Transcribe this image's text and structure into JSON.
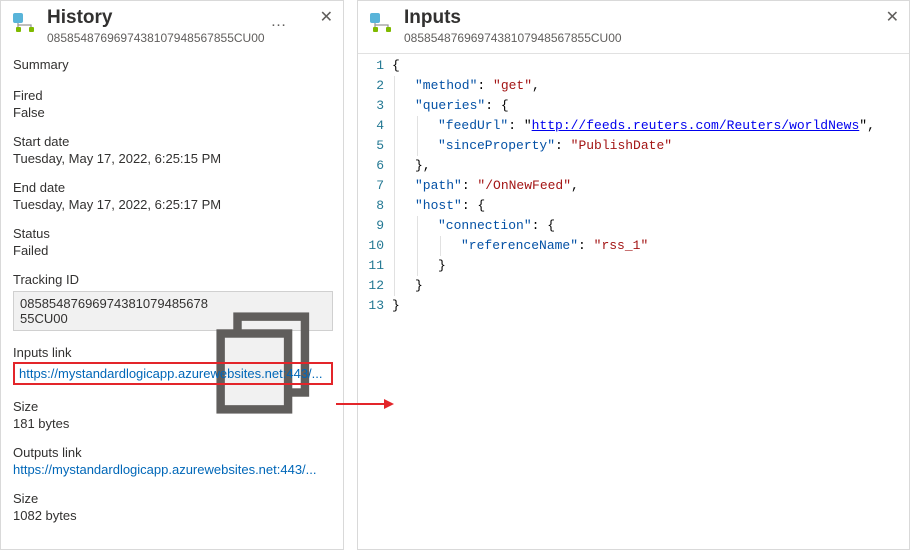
{
  "history": {
    "title": "History",
    "more": "…",
    "id": "08585487696974381079485678​55CU00",
    "summary_label": "Summary",
    "fired_label": "Fired",
    "fired_value": "False",
    "start_label": "Start date",
    "start_value": "Tuesday, May 17, 2022, 6:25:15 PM",
    "end_label": "End date",
    "end_value": "Tuesday, May 17, 2022, 6:25:17 PM",
    "status_label": "Status",
    "status_value": "Failed",
    "tracking_label": "Tracking ID",
    "tracking_value": "08585487696974381079485678​55CU00",
    "inputs_link_label": "Inputs link",
    "inputs_link_value": "https://mystandardlogicapp.azurewebsites.net:443/...",
    "inputs_size_label": "Size",
    "inputs_size_value": "181 bytes",
    "outputs_link_label": "Outputs link",
    "outputs_link_value": "https://mystandardlogicapp.azurewebsites.net:443/...",
    "outputs_size_label": "Size",
    "outputs_size_value": "1082 bytes"
  },
  "inputs": {
    "title": "Inputs",
    "id": "08585487696974381079485678​55CU00",
    "json": {
      "method": "get",
      "queries": {
        "feedUrl": "http://feeds.reuters.com/Reuters/worldNews",
        "sinceProperty": "PublishDate"
      },
      "path": "/OnNewFeed",
      "host": {
        "connection": {
          "referenceName": "rss_1"
        }
      }
    },
    "code_tokens": [
      [
        {
          "t": "punc",
          "v": "{"
        }
      ],
      [
        {
          "t": "indent",
          "n": 1
        },
        {
          "t": "key",
          "v": "\"method\""
        },
        {
          "t": "punc",
          "v": ": "
        },
        {
          "t": "str",
          "v": "\"get\""
        },
        {
          "t": "punc",
          "v": ","
        }
      ],
      [
        {
          "t": "indent",
          "n": 1
        },
        {
          "t": "key",
          "v": "\"queries\""
        },
        {
          "t": "punc",
          "v": ": {"
        }
      ],
      [
        {
          "t": "indent",
          "n": 2
        },
        {
          "t": "key",
          "v": "\"feedUrl\""
        },
        {
          "t": "punc",
          "v": ": \""
        },
        {
          "t": "link",
          "v": "http://feeds.reuters.com/Reuters/worldNews"
        },
        {
          "t": "punc",
          "v": "\","
        }
      ],
      [
        {
          "t": "indent",
          "n": 2
        },
        {
          "t": "key",
          "v": "\"sinceProperty\""
        },
        {
          "t": "punc",
          "v": ": "
        },
        {
          "t": "str",
          "v": "\"PublishDate\""
        }
      ],
      [
        {
          "t": "indent",
          "n": 1
        },
        {
          "t": "punc",
          "v": "},"
        }
      ],
      [
        {
          "t": "indent",
          "n": 1
        },
        {
          "t": "key",
          "v": "\"path\""
        },
        {
          "t": "punc",
          "v": ": "
        },
        {
          "t": "str",
          "v": "\"/OnNewFeed\""
        },
        {
          "t": "punc",
          "v": ","
        }
      ],
      [
        {
          "t": "indent",
          "n": 1
        },
        {
          "t": "key",
          "v": "\"host\""
        },
        {
          "t": "punc",
          "v": ": {"
        }
      ],
      [
        {
          "t": "indent",
          "n": 2
        },
        {
          "t": "key",
          "v": "\"connection\""
        },
        {
          "t": "punc",
          "v": ": {"
        }
      ],
      [
        {
          "t": "indent",
          "n": 3
        },
        {
          "t": "key",
          "v": "\"referenceName\""
        },
        {
          "t": "punc",
          "v": ": "
        },
        {
          "t": "str",
          "v": "\"rss_1\""
        }
      ],
      [
        {
          "t": "indent",
          "n": 2
        },
        {
          "t": "punc",
          "v": "}"
        }
      ],
      [
        {
          "t": "indent",
          "n": 1
        },
        {
          "t": "punc",
          "v": "}"
        }
      ],
      [
        {
          "t": "punc",
          "v": "}"
        }
      ]
    ]
  }
}
